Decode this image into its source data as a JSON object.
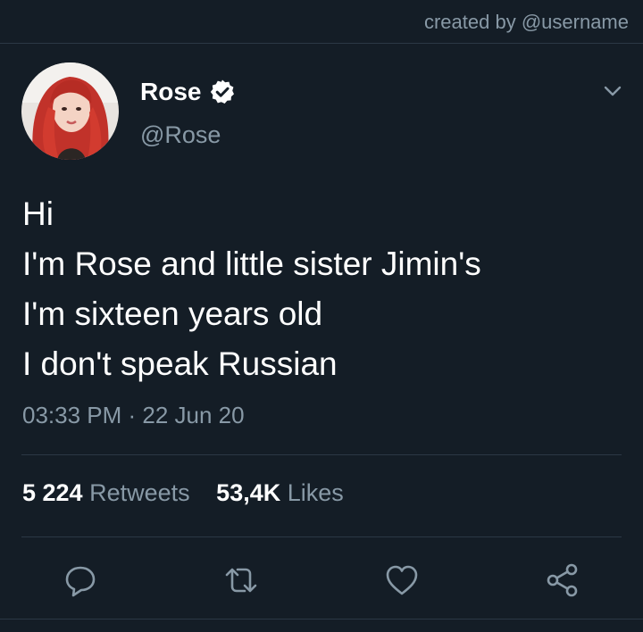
{
  "header": {
    "watermark": "created by @username"
  },
  "user": {
    "display_name": "Rose",
    "handle": "@Rose",
    "verified": true,
    "avatar_icon": "profile-photo"
  },
  "tweet": {
    "lines": [
      "Hi",
      "I'm Rose and little sister Jimin's",
      "I'm sixteen years old",
      "I don't speak Russian"
    ],
    "timestamp": "03:33 PM · 22 Jun 20"
  },
  "stats": {
    "retweets_count": "5 224",
    "retweets_label": "Retweets",
    "likes_count": "53,4K",
    "likes_label": "Likes"
  },
  "actions": {
    "icons": [
      "reply-icon",
      "retweet-icon",
      "like-icon",
      "share-icon"
    ]
  },
  "colors": {
    "background": "#141d26",
    "secondary_text": "#8899a6",
    "divider": "#2b3845",
    "primary_text": "#ffffff"
  }
}
